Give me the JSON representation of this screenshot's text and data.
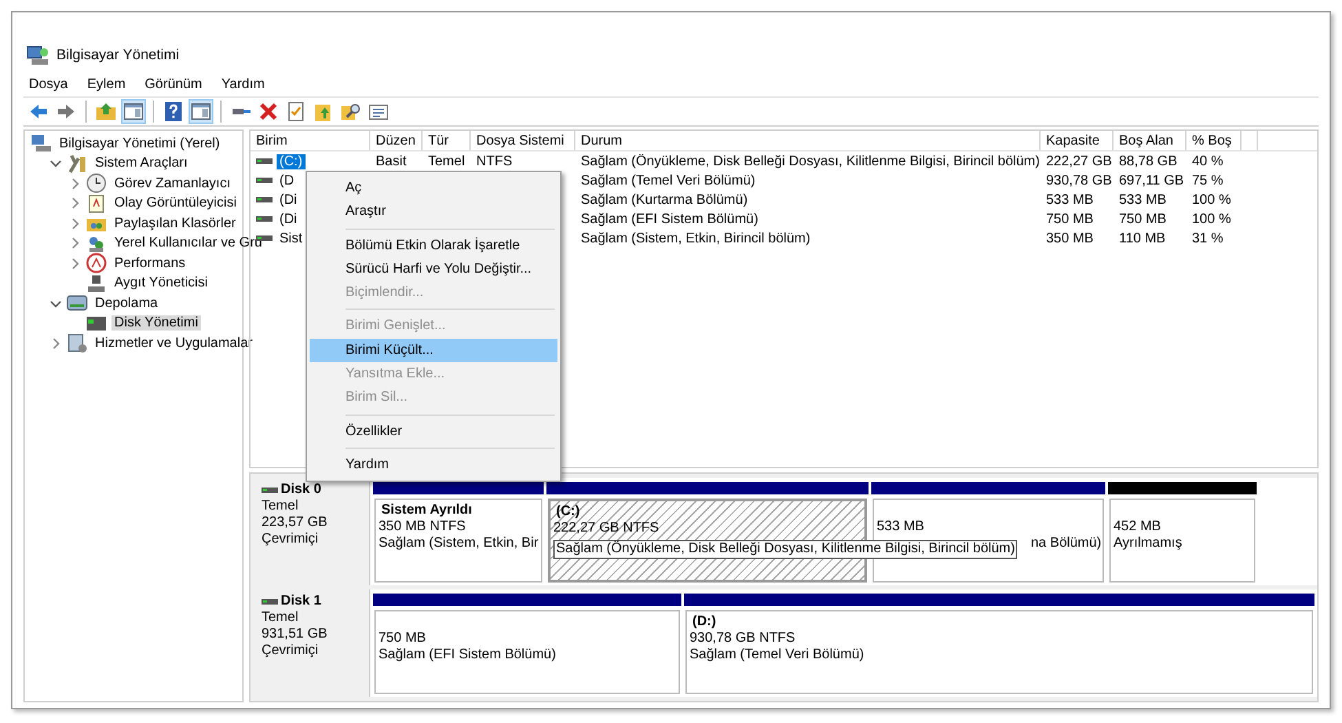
{
  "window": {
    "title": "Bilgisayar Yönetimi"
  },
  "menu": [
    "Dosya",
    "Eylem",
    "Görünüm",
    "Yardım"
  ],
  "toolbar": [
    {
      "kind": "back",
      "pressed": false
    },
    {
      "kind": "forward",
      "pressed": false
    },
    {
      "kind": "sep"
    },
    {
      "kind": "up",
      "pressed": false
    },
    {
      "kind": "pane",
      "pressed": true
    },
    {
      "kind": "sep"
    },
    {
      "kind": "help",
      "pressed": false
    },
    {
      "kind": "pane",
      "pressed": true
    },
    {
      "kind": "sep"
    },
    {
      "kind": "connect",
      "pressed": false
    },
    {
      "kind": "delete",
      "pressed": false
    },
    {
      "kind": "check",
      "pressed": false
    },
    {
      "kind": "folderup",
      "pressed": false
    },
    {
      "kind": "search",
      "pressed": false
    },
    {
      "kind": "props",
      "pressed": false
    }
  ],
  "tree": [
    {
      "label": "Bilgisayar Yönetimi (Yerel)",
      "selected": false,
      "children": [
        {
          "label": "Sistem Araçları",
          "expanded": true,
          "selected": false,
          "children": [
            {
              "label": "Görev Zamanlayıcı",
              "expanded": false,
              "selected": false
            },
            {
              "label": "Olay Görüntüleyicisi",
              "expanded": false,
              "selected": false
            },
            {
              "label": "Paylaşılan Klasörler",
              "expanded": false,
              "selected": false
            },
            {
              "label": "Yerel Kullanıcılar ve Gru",
              "expanded": false,
              "selected": false
            },
            {
              "label": "Performans",
              "expanded": false,
              "selected": false
            },
            {
              "label": "Aygıt Yöneticisi",
              "selected": false
            }
          ]
        },
        {
          "label": "Depolama",
          "expanded": true,
          "selected": false,
          "children": [
            {
              "label": "Disk Yönetimi",
              "selected": true
            }
          ]
        },
        {
          "label": "Hizmetler ve Uygulamalar",
          "expanded": false,
          "selected": false
        }
      ]
    }
  ],
  "table": {
    "columns": [
      "Birim",
      "Düzen",
      "Tür",
      "Dosya Sistemi",
      "Durum",
      "Kapasite",
      "Boş Alan",
      "% Boş"
    ],
    "rows": [
      {
        "selected": true,
        "cells": [
          "(C:)",
          "Basit",
          "Temel",
          "NTFS",
          "Sağlam (Önyükleme, Disk Belleği Dosyası, Kilitlenme Bilgisi, Birincil bölüm)",
          "222,27 GB",
          "88,78 GB",
          "40 %"
        ]
      },
      {
        "selected": false,
        "cells": [
          "(D",
          "",
          "",
          "",
          "Sağlam (Temel Veri Bölümü)",
          "930,78 GB",
          "697,11 GB",
          "75 %"
        ]
      },
      {
        "selected": false,
        "cells": [
          "(Di",
          "",
          "",
          "",
          "Sağlam (Kurtarma Bölümü)",
          "533 MB",
          "533 MB",
          "100 %"
        ]
      },
      {
        "selected": false,
        "cells": [
          "(Di",
          "",
          "",
          "",
          "Sağlam (EFI Sistem Bölümü)",
          "750 MB",
          "750 MB",
          "100 %"
        ]
      },
      {
        "selected": false,
        "cells": [
          "Sist",
          "",
          "",
          "",
          "Sağlam (Sistem, Etkin, Birincil bölüm)",
          "350 MB",
          "110 MB",
          "31 %"
        ]
      }
    ]
  },
  "context_menu": [
    {
      "label": "Aç",
      "disabled": false,
      "selected": false
    },
    {
      "label": "Araştır",
      "disabled": false,
      "selected": false
    },
    {
      "kind": "sep"
    },
    {
      "label": "Bölümü Etkin Olarak İşaretle",
      "disabled": false,
      "selected": false
    },
    {
      "label": "Sürücü Harfi ve Yolu Değiştir...",
      "disabled": false,
      "selected": false
    },
    {
      "label": "Biçimlendir...",
      "disabled": true,
      "selected": false
    },
    {
      "kind": "sep"
    },
    {
      "label": "Birimi Genişlet...",
      "disabled": true,
      "selected": false
    },
    {
      "label": "Birimi Küçült...",
      "disabled": false,
      "selected": true
    },
    {
      "label": "Yansıtma Ekle...",
      "disabled": true,
      "selected": false
    },
    {
      "label": "Birim Sil...",
      "disabled": true,
      "selected": false
    },
    {
      "kind": "sep"
    },
    {
      "label": "Özellikler",
      "disabled": false,
      "selected": false
    },
    {
      "kind": "sep"
    },
    {
      "label": "Yardım",
      "disabled": false,
      "selected": false
    }
  ],
  "disks": [
    {
      "name": "Disk 0",
      "type": "Temel",
      "size": "223,57 GB",
      "status": "Çevrimiçi",
      "partitions": [
        {
          "kind": "allocated",
          "selected": false,
          "title": "Sistem Ayrıldı",
          "lines": [
            "350 MB NTFS",
            "Sağlam (Sistem, Etkin, Bir"
          ]
        },
        {
          "kind": "allocated",
          "selected": true,
          "title": "(C:)",
          "lines": [
            "222,27 GB NTFS"
          ],
          "tooltip": "Sağlam (Önyükleme, Disk Belleği Dosyası, Kilitlenme Bilgisi, Birincil bölüm)"
        },
        {
          "kind": "allocated",
          "selected": false,
          "overlapped": true,
          "lines": [
            "533 MB",
            "na Bölümü)"
          ]
        },
        {
          "kind": "unallocated",
          "selected": false,
          "lines": [
            "452 MB",
            "Ayrılmamış"
          ]
        }
      ]
    },
    {
      "name": "Disk 1",
      "type": "Temel",
      "size": "931,51 GB",
      "status": "Çevrimiçi",
      "partitions": [
        {
          "kind": "allocated",
          "selected": false,
          "lines": [
            "750 MB",
            "Sağlam (EFI Sistem Bölümü)"
          ]
        },
        {
          "kind": "allocated",
          "selected": false,
          "title": "(D:)",
          "lines": [
            "930,78 GB NTFS",
            "Sağlam (Temel Veri Bölümü)"
          ]
        }
      ]
    }
  ]
}
